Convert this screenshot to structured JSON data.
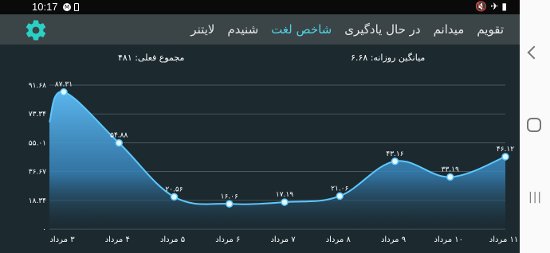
{
  "status_bar": {
    "time": "10:17",
    "notification_badge": "M",
    "right_icons": "🔇✈▮"
  },
  "toolbar": {
    "tabs": [
      {
        "label": "تقویم",
        "active": false
      },
      {
        "label": "میدانم",
        "active": false
      },
      {
        "label": "در حال یادگیری",
        "active": false
      },
      {
        "label": "شاخص لغت",
        "active": true
      },
      {
        "label": "شنیدم",
        "active": false
      },
      {
        "label": "لایتنر",
        "active": false
      }
    ],
    "settings_icon": "gear-icon",
    "accent_color": "#4fd3e6"
  },
  "summary": {
    "total": "مجموع فعلی: ۴۸۱",
    "daily_average": "میانگین روزانه: ۶.۶۸"
  },
  "chart_data": {
    "type": "area",
    "categories": [
      "۳ مرداد",
      "۴ مرداد",
      "۵ مرداد",
      "۶ مرداد",
      "۷ مرداد",
      "۸ مرداد",
      "۹ مرداد",
      "۱۰ مرداد",
      "۱۱ مرداد"
    ],
    "values": [
      87.31,
      54.88,
      20.56,
      16.06,
      17.19,
      21.06,
      43.16,
      33.19,
      46.12
    ],
    "value_labels": [
      "۸۷.۳۱",
      "۵۴.۸۸",
      "۲۰.۵۶",
      "۱۶.۰۶",
      "۱۷.۱۹",
      "۲۱.۰۶",
      "۴۳.۱۶",
      "۳۳.۱۹",
      "۴۶.۱۲"
    ],
    "y_ticks": [
      0,
      18.34,
      36.67,
      55.01,
      73.34,
      91.68
    ],
    "y_tick_labels": [
      "۰",
      "۱۸.۳۴",
      "۳۶.۶۷",
      "۵۵.۰۱",
      "۷۳.۳۴",
      "۹۱.۶۸"
    ],
    "ylim": [
      0,
      91.68
    ],
    "grid": true,
    "line_color": "#5cc8ff",
    "fill_color": "#4aa8e8"
  },
  "nav_bar": {
    "back_icon": "back-chevron-icon",
    "home_icon": "home-icon",
    "recent_icon": "recent-apps-icon",
    "recent_glyph": "|||"
  }
}
